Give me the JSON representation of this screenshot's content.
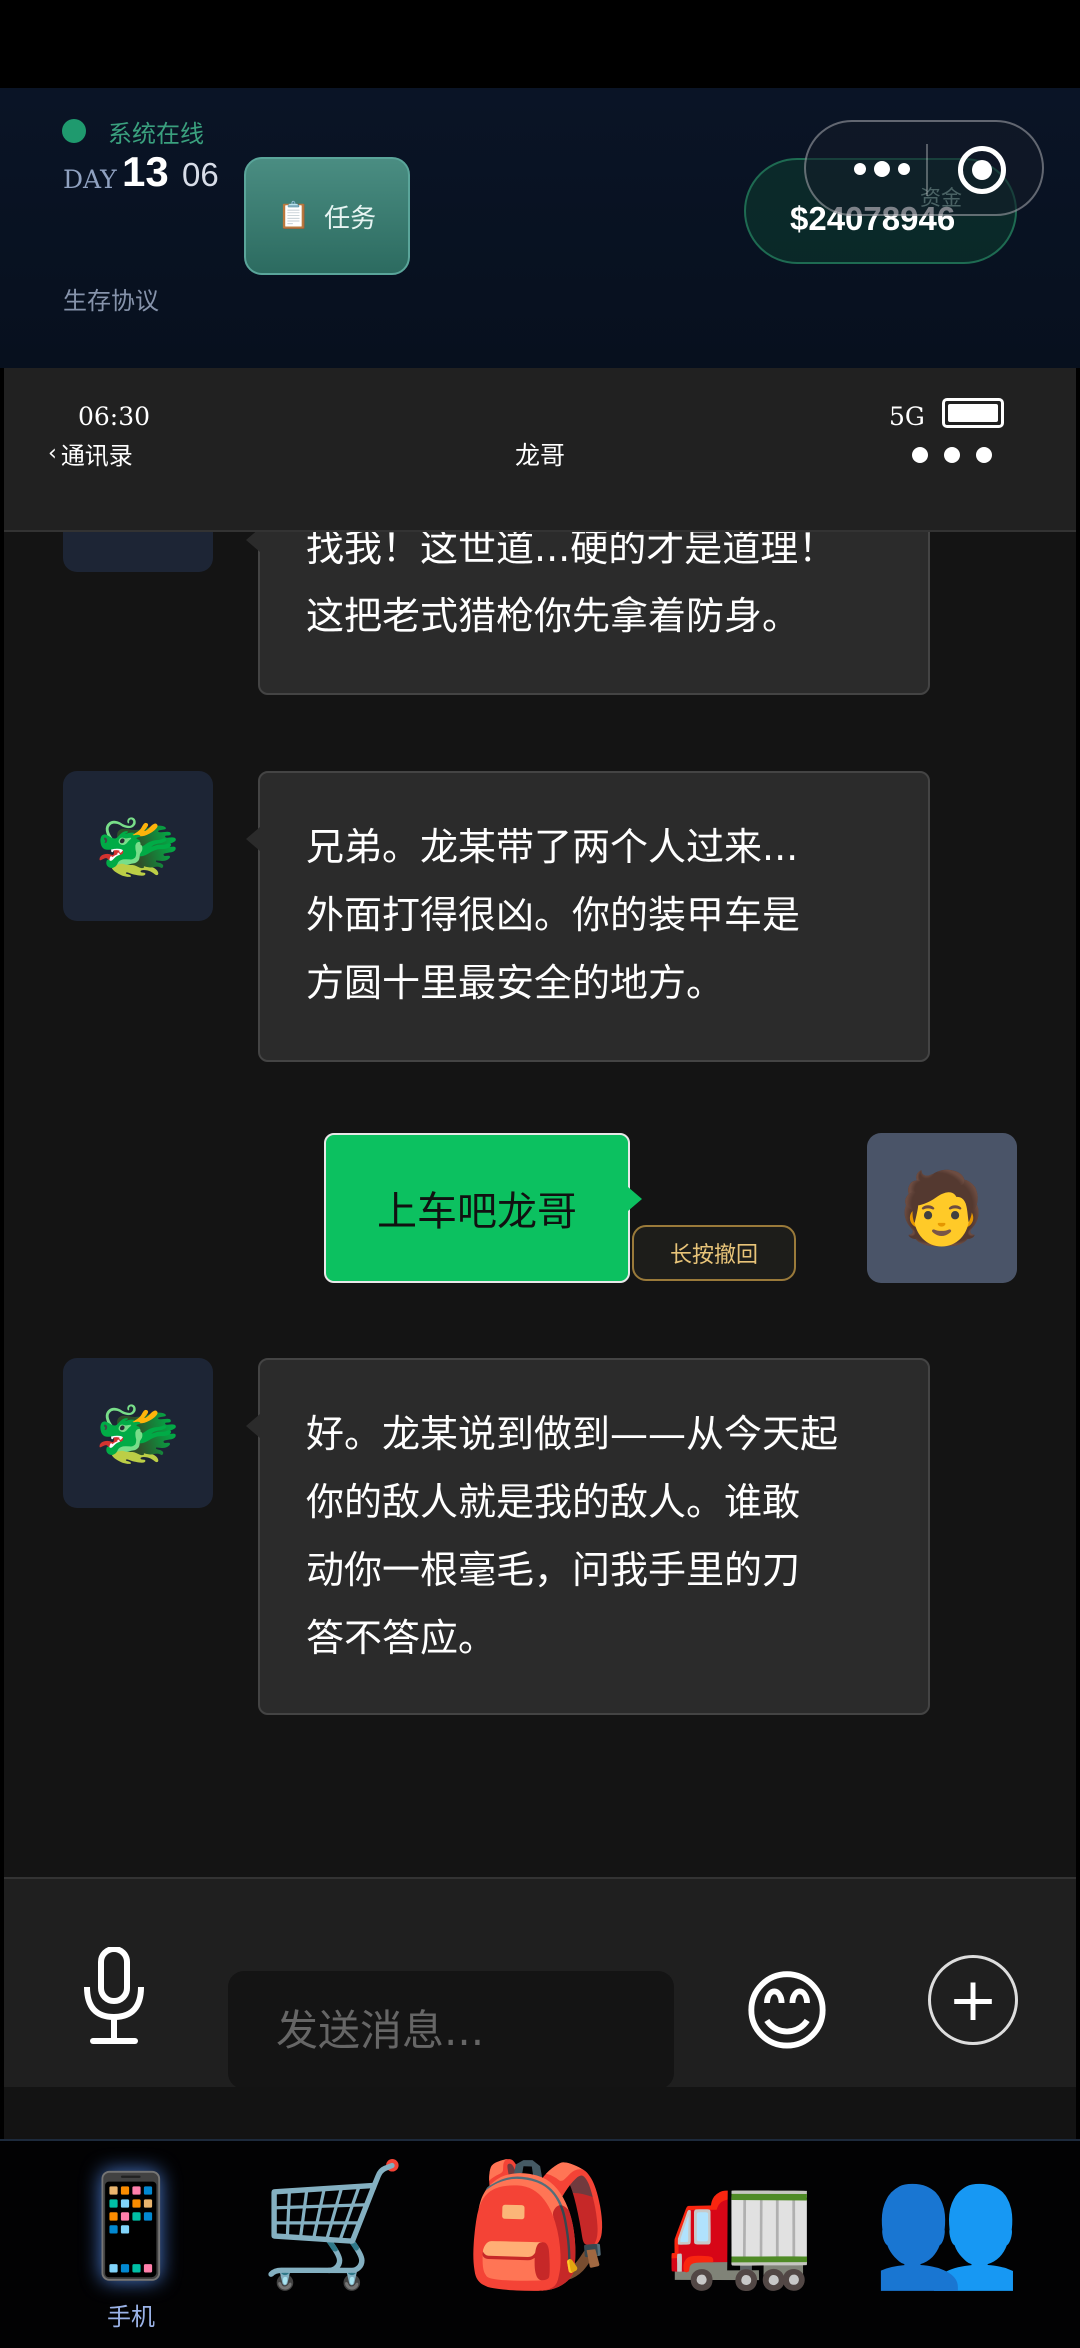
{
  "status": {
    "online_text": "系统在线",
    "day_label": "DAY",
    "day_number": "13",
    "day_time": "06",
    "protocol_text": "生存协议"
  },
  "task_button": {
    "icon": "clipboard-icon",
    "glyph": "📋",
    "label": "任务"
  },
  "funds": {
    "label": "资金",
    "value": "$24078946"
  },
  "capsule": {
    "more_icon": "more-dots-icon",
    "close_icon": "target-close-icon"
  },
  "phone": {
    "time": "06:30",
    "signal": "5G",
    "battery_icon": "battery-full-icon",
    "back_label": "通讯录",
    "contact_name": "龙哥"
  },
  "messages": [
    {
      "from": "npc",
      "avatar": "dragon-avatar",
      "lines": [
        "找我！这世道...硬的才是道理！",
        "这把老式猎枪你先拿着防身。"
      ]
    },
    {
      "from": "npc",
      "avatar": "dragon-avatar",
      "glyph": "🐲",
      "lines": [
        "兄弟。龙某带了两个人过来...",
        "外面打得很凶。你的装甲车是",
        "方圆十里最安全的地方。"
      ]
    },
    {
      "from": "me",
      "avatar": "person-avatar",
      "glyph": "🧑",
      "text": "上车吧龙哥",
      "recall_label": "长按撤回"
    },
    {
      "from": "npc",
      "avatar": "dragon-avatar",
      "glyph": "🐲",
      "lines": [
        "好。龙某说到做到——从今天起",
        "你的敌人就是我的敌人。谁敢",
        "动你一根毫毛，问我手里的刀",
        "答不答应。"
      ]
    }
  ],
  "input": {
    "placeholder": "发送消息...",
    "value": "",
    "emoji_glyph": "😊",
    "plus_glyph": "+"
  },
  "nav": [
    {
      "name": "phone",
      "glyph": "📱",
      "label": "手机",
      "active": true
    },
    {
      "name": "shop",
      "glyph": "🛒",
      "label": "",
      "active": false
    },
    {
      "name": "backpack",
      "glyph": "🎒",
      "label": "",
      "active": false
    },
    {
      "name": "truck",
      "glyph": "🚛",
      "label": "",
      "active": false
    },
    {
      "name": "team",
      "glyph": "👥",
      "label": "",
      "active": false
    }
  ],
  "colors": {
    "accent_green": "#0cc160",
    "online_green": "#1f9a6e",
    "nav_label": "#9bb3e8",
    "recall_gold": "#e8c479"
  }
}
